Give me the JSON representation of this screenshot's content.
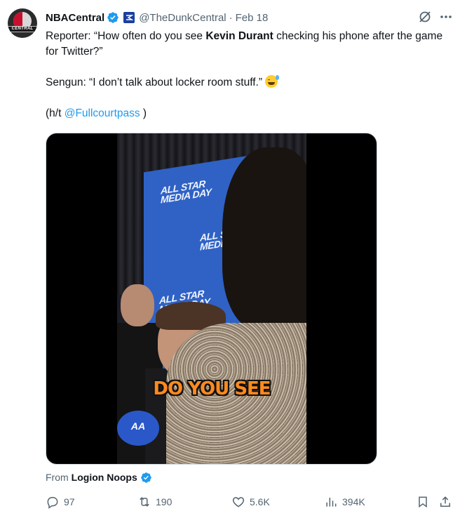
{
  "tweet": {
    "author_name": "NBACentral",
    "handle": "@TheDunkCentral",
    "separator": "·",
    "date": "Feb 18",
    "avatar_text": "CENTRAL",
    "text": {
      "line1_prefix": "Reporter: “How often do you see ",
      "line1_bold": "Kevin Durant",
      "line1_suffix": " checking his phone after the game for Twitter?”",
      "line2": "Sengun: “I don’t talk about locker room stuff.”",
      "line3_prefix": "(h/t ",
      "line3_mention": "@Fullcourtpass",
      "line3_suffix": " )"
    },
    "media": {
      "caption": "DO YOU SEE",
      "backdrop_logo": "ALL STAR\nMEDIA DAY",
      "mic_logo": "AA"
    },
    "from": {
      "label": "From",
      "author": "Logion Noops"
    },
    "actions": {
      "replies": "97",
      "reposts": "190",
      "likes": "5.6K",
      "views": "394K"
    },
    "colors": {
      "accent": "#1d9bf0",
      "secondary_text": "#536471",
      "primary_text": "#0f1419"
    }
  }
}
